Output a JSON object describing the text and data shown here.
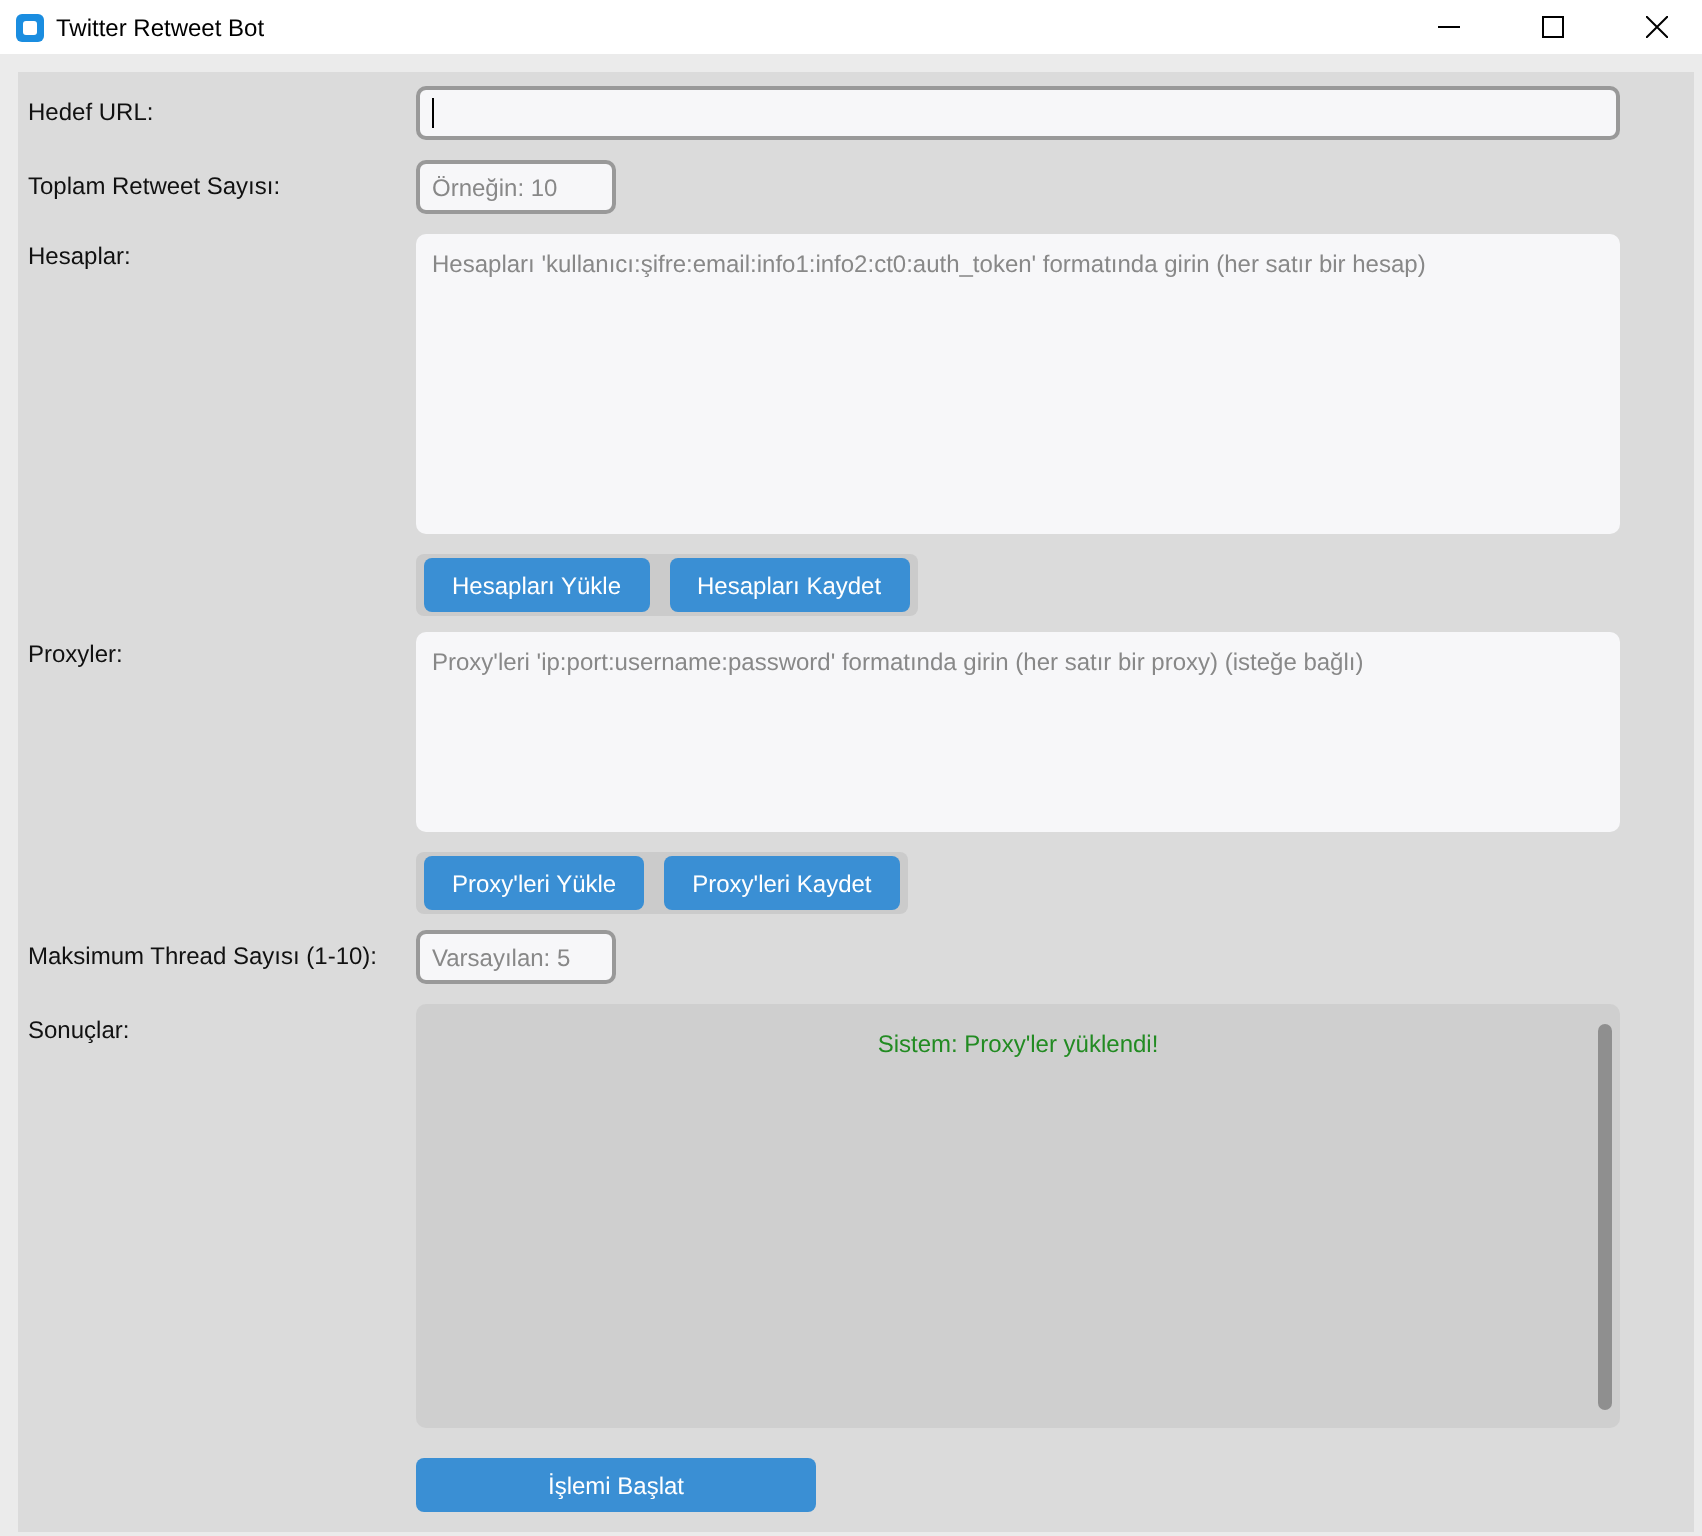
{
  "window": {
    "title": "Twitter Retweet Bot"
  },
  "rows": [
    {
      "kind": "input",
      "label": "Hedef URL:",
      "placeholder": "",
      "wide": true,
      "focused": true
    },
    {
      "kind": "input",
      "label": "Toplam Retweet Sayısı:",
      "placeholder": "Örneğin: 10",
      "wide": false,
      "focused": false
    },
    {
      "kind": "tall_textarea",
      "label": "Hesaplar:",
      "placeholder": "Hesapları 'kullanıcı:şifre:email:info1:info2:ct0:auth_token' formatında girin (her satır bir hesap)"
    },
    {
      "kind": "buttons",
      "buttons": [
        "Hesapları Yükle",
        "Hesapları Kaydet"
      ]
    },
    {
      "kind": "short_textarea",
      "label": "Proxyler:",
      "placeholder": "Proxy'leri 'ip:port:username:password' formatında girin (her satır bir proxy) (isteğe bağlı)"
    },
    {
      "kind": "buttons",
      "buttons": [
        "Proxy'leri Yükle",
        "Proxy'leri Kaydet"
      ]
    },
    {
      "kind": "input",
      "label": "Maksimum Thread Sayısı (1-10):",
      "placeholder": "Varsayılan: 5",
      "wide": false,
      "focused": false
    },
    {
      "kind": "log",
      "label": "Sonuçlar:",
      "lines": [
        "Sistem: Proxy'ler yüklendi!"
      ]
    },
    {
      "kind": "start",
      "button": "İşlemi Başlat"
    }
  ]
}
